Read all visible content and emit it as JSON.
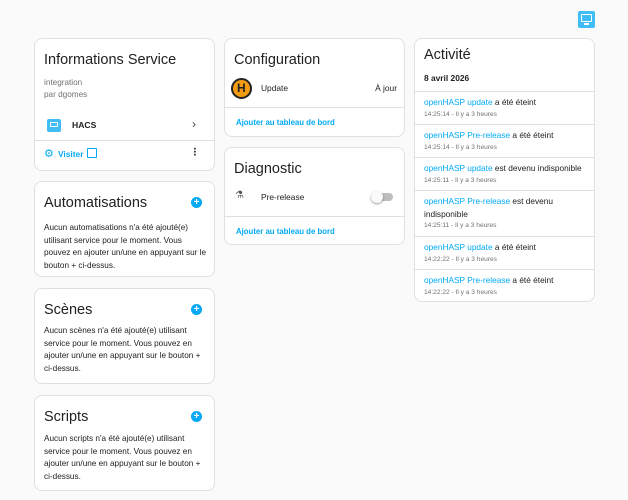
{
  "info": {
    "title": "Informations Service",
    "subtitle1": "integration",
    "subtitle2": "par dgomes",
    "device_name": "HACS",
    "visit_label": "Visiter"
  },
  "automations": {
    "title": "Automatisations",
    "text": "Aucun automatisations n'a été ajouté(e) utilisant service pour le moment. Vous pouvez en ajouter un/une en appuyant sur le bouton + ci-dessus."
  },
  "scenes": {
    "title": "Scènes",
    "text": "Aucun scènes n'a été ajouté(e) utilisant service pour le moment. Vous pouvez en ajouter un/une en appuyant sur le bouton + ci-dessus."
  },
  "scripts": {
    "title": "Scripts",
    "text": "Aucun scripts n'a été ajouté(e) utilisant service pour le moment. Vous pouvez en ajouter un/une en appuyant sur le bouton + ci-dessus."
  },
  "configuration": {
    "title": "Configuration",
    "entity_name": "Update",
    "entity_state": "À jour",
    "add_link": "Ajouter au tableau de bord"
  },
  "diagnostic": {
    "title": "Diagnostic",
    "entity_name": "Pre-release",
    "toggle_on": false,
    "add_link": "Ajouter au tableau de bord"
  },
  "activity": {
    "title": "Activité",
    "date": "8 avril 2026",
    "entries": [
      {
        "entity": "openHASP update",
        "text": " a été éteint",
        "time": "14:25:14 - Il y a 3 heures"
      },
      {
        "entity": "openHASP Pre-release",
        "text": " a été éteint",
        "time": "14:25:14 - Il y a 3 heures"
      },
      {
        "entity": "openHASP update",
        "text": " est devenu indisponible",
        "time": "14:25:11 - Il y a 3 heures"
      },
      {
        "entity": "openHASP Pre-release",
        "text": " est devenu indisponible",
        "time": "14:25:11 - Il y a 3 heures"
      },
      {
        "entity": "openHASP update",
        "text": " a été éteint",
        "time": "14:22:22 - Il y a 3 heures"
      },
      {
        "entity": "openHASP Pre-release",
        "text": " a été éteint",
        "time": "14:22:22 - Il y a 3 heures"
      }
    ]
  },
  "colors": {
    "accent": "#03a9f4",
    "hacs": "#41bdf5",
    "card_border": "#e0e0e0"
  }
}
